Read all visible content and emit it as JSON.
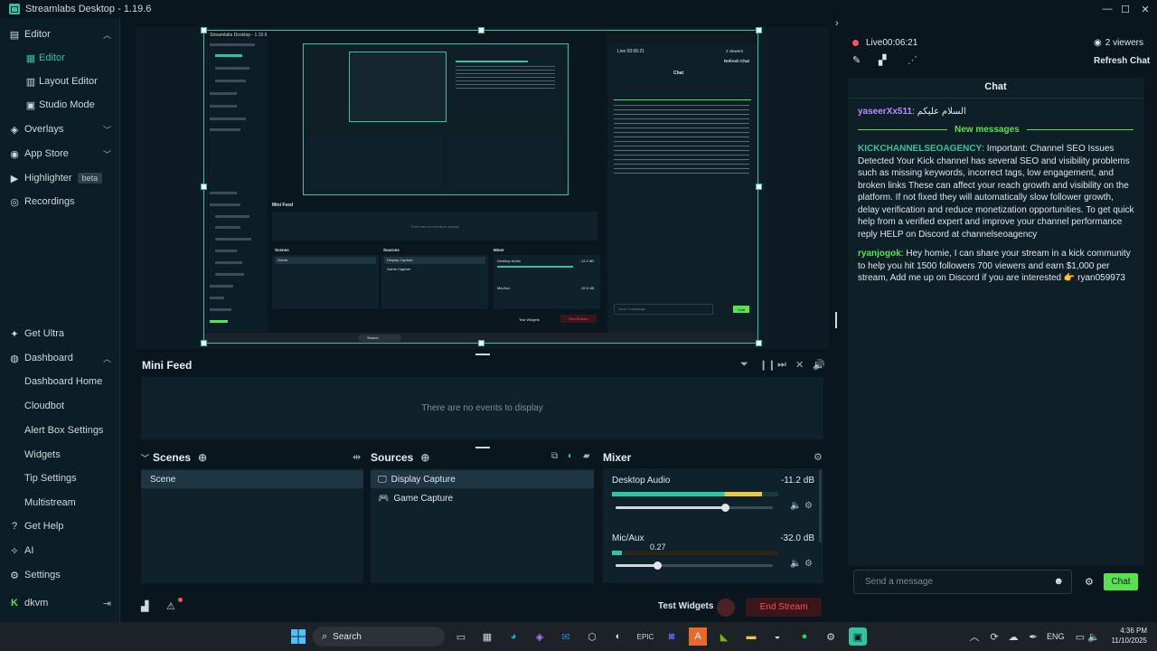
{
  "app": {
    "title": "Streamlabs Desktop - 1.19.6"
  },
  "sidebar": {
    "items": [
      {
        "label": "Editor",
        "icon": "layers-icon",
        "chevron": "^",
        "level": "top"
      },
      {
        "label": "Editor",
        "icon": "editor-icon",
        "level": "sub",
        "active": true
      },
      {
        "label": "Layout Editor",
        "icon": "layout-icon",
        "level": "sub"
      },
      {
        "label": "Studio Mode",
        "icon": "studio-icon",
        "level": "sub"
      },
      {
        "label": "Overlays",
        "icon": "overlays-icon",
        "chevron": "v",
        "level": "top"
      },
      {
        "label": "App Store",
        "icon": "store-icon",
        "chevron": "v",
        "level": "top"
      },
      {
        "label": "Highlighter",
        "icon": "highlighter-icon",
        "badge": "beta",
        "level": "top"
      },
      {
        "label": "Recordings",
        "icon": "record-icon",
        "level": "top"
      }
    ],
    "bottom_items": [
      {
        "label": "Get Ultra",
        "icon": "ultra-icon"
      },
      {
        "label": "Dashboard",
        "icon": "dashboard-icon",
        "chevron": "^"
      },
      {
        "label": "Dashboard Home"
      },
      {
        "label": "Cloudbot"
      },
      {
        "label": "Alert Box Settings"
      },
      {
        "label": "Widgets"
      },
      {
        "label": "Tip Settings"
      },
      {
        "label": "Multistream"
      },
      {
        "label": "Get Help",
        "icon": "help-icon"
      },
      {
        "label": "AI",
        "icon": "ai-icon"
      },
      {
        "label": "Settings",
        "icon": "gear-icon"
      },
      {
        "label": "dkvm",
        "icon": "kick-icon"
      }
    ]
  },
  "preview": {
    "mini_title": "Streamlabs Desktop - 1.19.6",
    "mini_feed": "Mini Feed",
    "mini_no_events": "There are no events to display",
    "mini_scenes": "Scenes",
    "mini_scene": "Scene",
    "mini_sources": "Sources",
    "mini_display": "Display Capture",
    "mini_game": "Game Capture",
    "mini_mixer": "Mixer",
    "mini_desktop_audio": "Desktop Audio",
    "mini_mic": "Mic/Aux",
    "mini_db1": "-11.2 dB",
    "mini_db2": "-32.0 dB",
    "mini_test": "Test Widgets",
    "mini_end": "End Stream",
    "mini_live": "Live 00:06:21",
    "mini_viewers": "2 viewers",
    "mini_refresh": "Refresh Chat",
    "mini_chat": "Chat",
    "mini_send": "Send a message",
    "mini_chat_btn": "Chat",
    "mini_search": "Search"
  },
  "mini_feed": {
    "title": "Mini Feed",
    "empty": "There are no events to display"
  },
  "scenes": {
    "title": "Scenes",
    "items": [
      "Scene"
    ]
  },
  "sources": {
    "title": "Sources",
    "items": [
      {
        "label": "Display Capture",
        "icon": "monitor-icon"
      },
      {
        "label": "Game Capture",
        "icon": "gamepad-icon"
      }
    ]
  },
  "mixer": {
    "title": "Mixer",
    "channels": [
      {
        "name": "Desktop Audio",
        "db": "-11.2 dB",
        "level": 0.9,
        "volume": 0.7
      },
      {
        "name": "Mic/Aux",
        "db": "-32.0 dB",
        "level": 0.06,
        "volume": 0.27,
        "tooltip": "0.27"
      }
    ]
  },
  "footer": {
    "test_widgets": "Test Widgets",
    "end_stream": "End Stream"
  },
  "stream": {
    "live": "Live",
    "time": "00:06:21",
    "viewers": "2 viewers",
    "refresh": "Refresh Chat"
  },
  "chat": {
    "title": "Chat",
    "first": {
      "user": "yaseerXx511",
      "text": "السلام عليكم"
    },
    "divider": "New messages",
    "messages": [
      {
        "user": "KICKCHANNELSEOAGENCY",
        "color": "#31c3a2",
        "text": "Important: Channel SEO Issues Detected Your Kick channel has several SEO and visibility problems such as missing keywords, incorrect tags, low engagement, and broken links These can affect your reach growth and visibility on the platform. If not fixed they will automatically slow follower growth, delay verification and reduce monetization opportunities. To get quick help from a verified expert and improve your channel performance reply HELP on Discord at channelseoagency"
      },
      {
        "user": "ryanjogok",
        "color": "#56e34d",
        "text": "Hey homie, I can share your stream in a kick community to help you hit 1500 followers 700 viewers and earn $1,000 per stream, Add me up on Discord if you are interested 👉 ryan059973"
      }
    ],
    "input_placeholder": "Send a message",
    "send_label": "Chat"
  },
  "taskbar": {
    "search": "Search",
    "lang": "ENG",
    "time": "4:36 PM",
    "date": "11/10/2025"
  },
  "colors": {
    "accent": "#31c3a2",
    "end_stream": "#ff4f5d",
    "chat_button": "#56e34d"
  }
}
